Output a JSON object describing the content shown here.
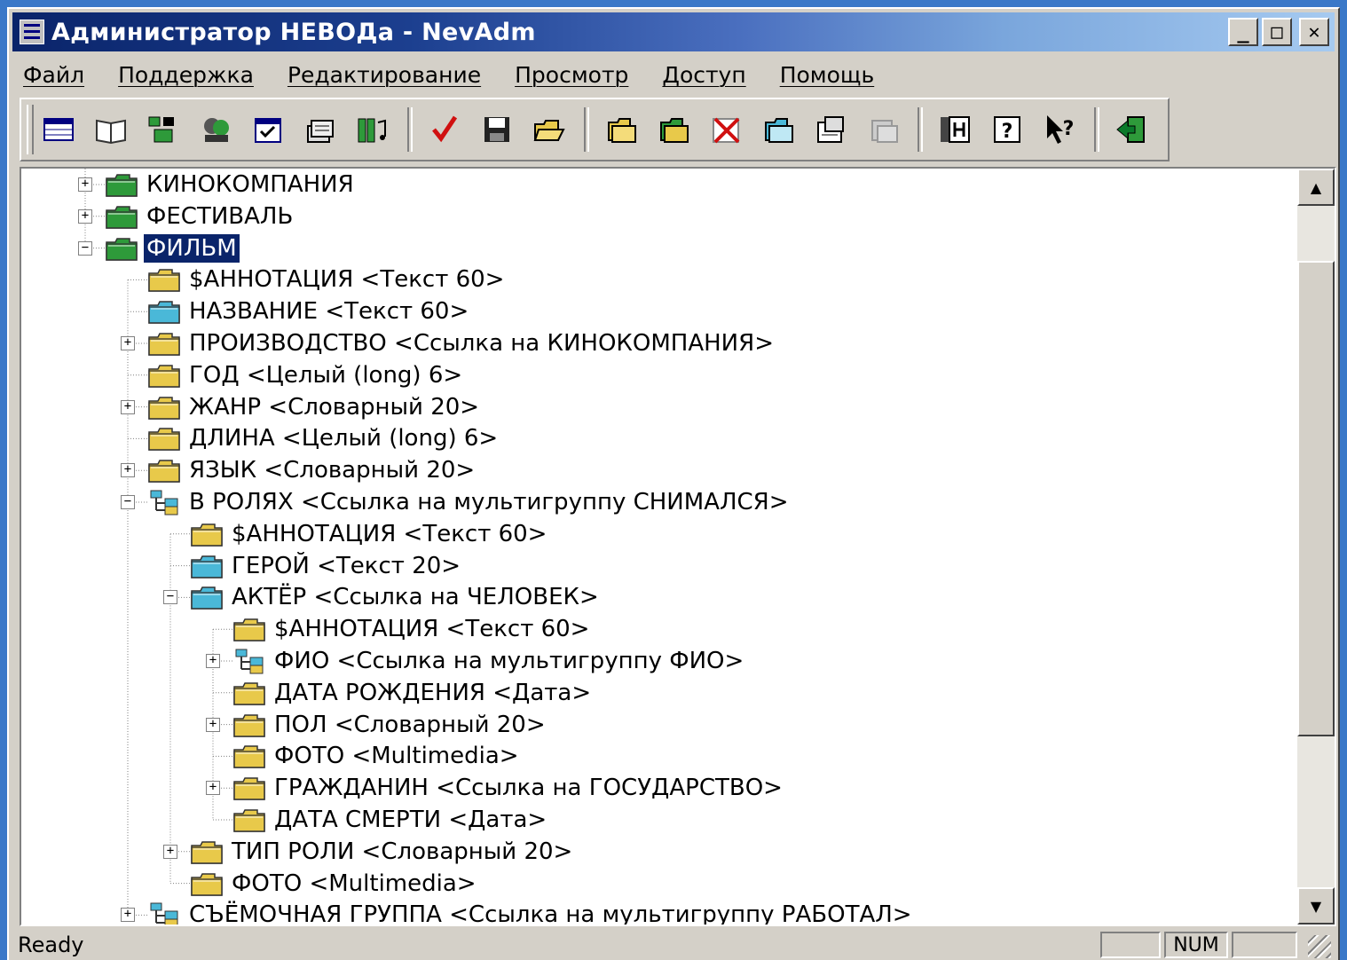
{
  "window": {
    "title": "Администратор НЕВОДа - NevAdm",
    "minimize": "_",
    "maximize": "□",
    "close": "✕"
  },
  "menu": [
    "Файл",
    "Поддержка",
    "Редактирование",
    "Просмотр",
    "Доступ",
    "Помощь"
  ],
  "toolbar": {
    "groups": [
      [
        "table-icon",
        "book-icon",
        "database-icon",
        "users-icon",
        "calendar-icon",
        "stack-icon",
        "music-icon"
      ],
      [
        "check-icon",
        "save-icon",
        "open-folder-icon"
      ],
      [
        "new-item-icon",
        "copy-item-icon",
        "delete-icon",
        "link-icon",
        "properties-icon",
        "disabled-item-icon"
      ],
      [
        "index-icon",
        "help-icon",
        "context-help-icon"
      ],
      [
        "exit-icon"
      ]
    ]
  },
  "tree": {
    "nodes": [
      {
        "label": "КИНОКОМПАНИЯ",
        "level": 0,
        "expander": "+",
        "icon": "folder-green"
      },
      {
        "label": "ФЕСТИВАЛЬ",
        "level": 0,
        "expander": "+",
        "icon": "folder-green"
      },
      {
        "label": "ФИЛЬМ",
        "level": 0,
        "expander": "-",
        "icon": "folder-green",
        "selected": true
      },
      {
        "label": "$АННОТАЦИЯ <Текст 60>",
        "level": 1,
        "expander": "",
        "icon": "folder-yellow"
      },
      {
        "label": "НАЗВАНИЕ <Текст 60>",
        "level": 1,
        "expander": "",
        "icon": "folder-cyan"
      },
      {
        "label": "ПРОИЗВОДСТВО  <Ссылка на КИНОКОМПАНИЯ>",
        "level": 1,
        "expander": "+",
        "icon": "folder-yellow"
      },
      {
        "label": "ГОД <Целый (long) 6>",
        "level": 1,
        "expander": "",
        "icon": "folder-yellow"
      },
      {
        "label": "ЖАНР  <Словарный 20>",
        "level": 1,
        "expander": "+",
        "icon": "folder-yellow"
      },
      {
        "label": "ДЛИНА <Целый (long) 6>",
        "level": 1,
        "expander": "",
        "icon": "folder-yellow"
      },
      {
        "label": "ЯЗЫК  <Словарный 20>",
        "level": 1,
        "expander": "+",
        "icon": "folder-yellow"
      },
      {
        "label": "В РОЛЯХ  <Ссылка на мультигруппу СНИМАЛСЯ>",
        "level": 1,
        "expander": "-",
        "icon": "multigroup"
      },
      {
        "label": "$АННОТАЦИЯ <Текст 60>",
        "level": 2,
        "expander": "",
        "icon": "folder-yellow"
      },
      {
        "label": "ГЕРОЙ <Текст 20>",
        "level": 2,
        "expander": "",
        "icon": "folder-cyan"
      },
      {
        "label": "АКТЁР  <Ссылка на ЧЕЛОВЕК>",
        "level": 2,
        "expander": "-",
        "icon": "folder-cyan"
      },
      {
        "label": "$АННОТАЦИЯ <Текст 60>",
        "level": 3,
        "expander": "",
        "icon": "folder-yellow"
      },
      {
        "label": "ФИО  <Ссылка на мультигруппу ФИО>",
        "level": 3,
        "expander": "+",
        "icon": "multigroup"
      },
      {
        "label": "ДАТА РОЖДЕНИЯ <Дата>",
        "level": 3,
        "expander": "",
        "icon": "folder-yellow"
      },
      {
        "label": "ПОЛ  <Словарный 20>",
        "level": 3,
        "expander": "+",
        "icon": "folder-yellow"
      },
      {
        "label": "ФОТО <Multimedia>",
        "level": 3,
        "expander": "",
        "icon": "folder-yellow"
      },
      {
        "label": "ГРАЖДАНИН  <Ссылка на ГОСУДАРСТВО>",
        "level": 3,
        "expander": "+",
        "icon": "folder-yellow"
      },
      {
        "label": "ДАТА СМЕРТИ <Дата>",
        "level": 3,
        "expander": "",
        "icon": "folder-yellow"
      },
      {
        "label": "ТИП РОЛИ  <Словарный 20>",
        "level": 2,
        "expander": "+",
        "icon": "folder-yellow"
      },
      {
        "label": "ФОТО <Multimedia>",
        "level": 2,
        "expander": "",
        "icon": "folder-yellow"
      },
      {
        "label": "СЪЁМОЧНАЯ ГРУППА  <Ссылка на мультигруппу РАБОТАЛ>",
        "level": 1,
        "expander": "+",
        "icon": "multigroup"
      }
    ]
  },
  "scrollbar": {
    "up": "▲",
    "down": "▼"
  },
  "statusbar": {
    "text": "Ready",
    "panes": [
      "",
      "NUM",
      ""
    ]
  },
  "colors": {
    "folder_green": "#2e9a3a",
    "folder_yellow": "#e8c94a",
    "folder_cyan": "#4ab8d8",
    "selection": "#0a246a"
  }
}
